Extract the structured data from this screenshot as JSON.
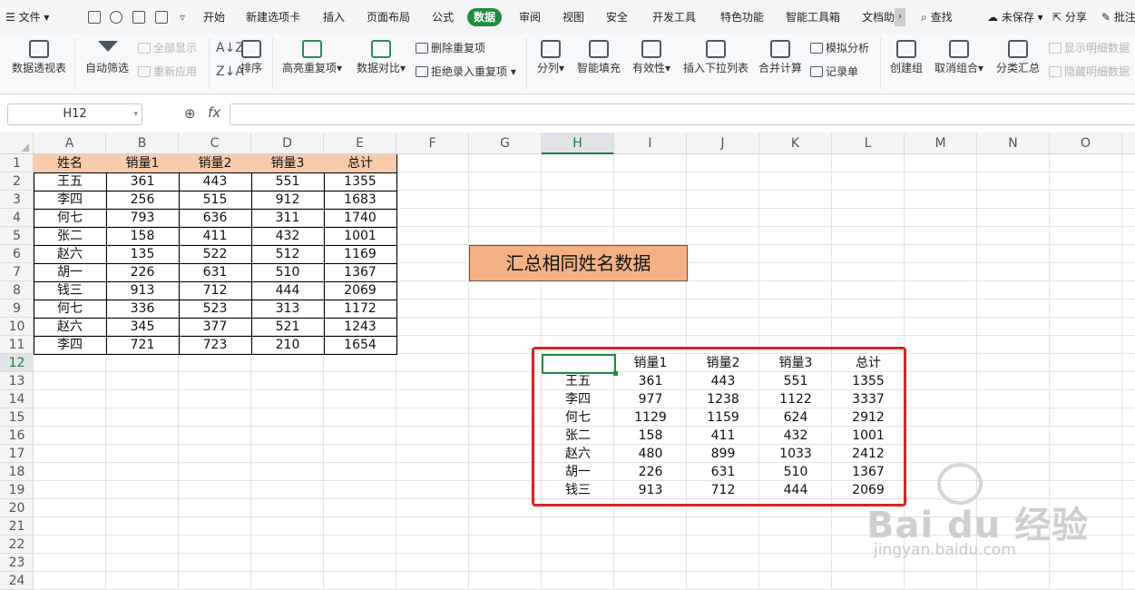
{
  "menu": {
    "file": "文件",
    "tabs": [
      "开始",
      "新建选项卡",
      "插入",
      "页面布局",
      "公式",
      "数据",
      "审阅",
      "视图",
      "安全",
      "开发工具",
      "特色功能",
      "智能工具箱",
      "文档助"
    ],
    "search": "查找",
    "unsaved": "未保存",
    "share": "分享",
    "comment": "批注"
  },
  "ribbon": {
    "pivot": "数据透视表",
    "autofilter": "自动筛选",
    "show_all": "全部显示",
    "reapply": "重新应用",
    "sort": "排序",
    "highlight_dup": "高亮重复项",
    "data_compare": "数据对比",
    "remove_dup": "删除重复项",
    "reject_dup": "拒绝录入重复项",
    "split": "分列",
    "smart_fill": "智能填充",
    "validity": "有效性",
    "insert_dropdown": "插入下拉列表",
    "consolidate": "合并计算",
    "simulate": "模拟分析",
    "record_sheet": "记录单",
    "create_group": "创建组",
    "ungroup": "取消组合",
    "subtotal": "分类汇总",
    "show_detail": "显示明细数据",
    "hide_detail": "隐藏明细数据"
  },
  "formula_bar": {
    "name_box": "H12",
    "fx": "fx",
    "value": ""
  },
  "columns": [
    "A",
    "B",
    "C",
    "D",
    "E",
    "F",
    "G",
    "H",
    "I",
    "J",
    "K",
    "L",
    "M",
    "N",
    "O"
  ],
  "rows": [
    "1",
    "2",
    "3",
    "4",
    "5",
    "6",
    "7",
    "8",
    "9",
    "10",
    "11",
    "12",
    "13",
    "14",
    "15",
    "16",
    "17",
    "18",
    "19",
    "20",
    "21",
    "22",
    "23",
    "24"
  ],
  "source_table": {
    "headers": [
      "姓名",
      "销量1",
      "销量2",
      "销量3",
      "总计"
    ],
    "rows": [
      [
        "王五",
        "361",
        "443",
        "551",
        "1355"
      ],
      [
        "李四",
        "256",
        "515",
        "912",
        "1683"
      ],
      [
        "何七",
        "793",
        "636",
        "311",
        "1740"
      ],
      [
        "张二",
        "158",
        "411",
        "432",
        "1001"
      ],
      [
        "赵六",
        "135",
        "522",
        "512",
        "1169"
      ],
      [
        "胡一",
        "226",
        "631",
        "510",
        "1367"
      ],
      [
        "钱三",
        "913",
        "712",
        "444",
        "2069"
      ],
      [
        "何七",
        "336",
        "523",
        "313",
        "1172"
      ],
      [
        "赵六",
        "345",
        "377",
        "521",
        "1243"
      ],
      [
        "李四",
        "721",
        "723",
        "210",
        "1654"
      ]
    ]
  },
  "summary_label": "汇总相同姓名数据",
  "summary_table": {
    "headers": [
      "",
      "销量1",
      "销量2",
      "销量3",
      "总计"
    ],
    "rows": [
      [
        "王五",
        "361",
        "443",
        "551",
        "1355"
      ],
      [
        "李四",
        "977",
        "1238",
        "1122",
        "3337"
      ],
      [
        "何七",
        "1129",
        "1159",
        "624",
        "2912"
      ],
      [
        "张二",
        "158",
        "411",
        "432",
        "1001"
      ],
      [
        "赵六",
        "480",
        "899",
        "1033",
        "2412"
      ],
      [
        "胡一",
        "226",
        "631",
        "510",
        "1367"
      ],
      [
        "钱三",
        "913",
        "712",
        "444",
        "2069"
      ]
    ]
  },
  "watermark": {
    "brand": "Bai du 经验",
    "url": "jingyan.baidu.com"
  },
  "colors": {
    "accent": "#1e8e3e",
    "header_fill": "#f8cbad",
    "label_fill": "#f4b183",
    "highlight_box": "#e0201f"
  }
}
